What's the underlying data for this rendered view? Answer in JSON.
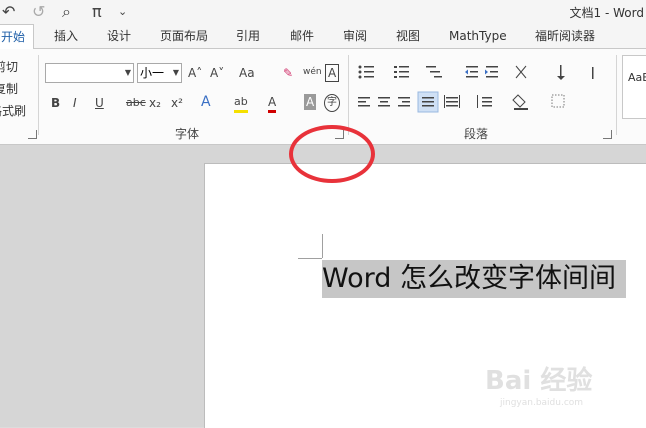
{
  "window": {
    "title": "文档1 - Word"
  },
  "qat": {
    "undo_icon": "↶",
    "redo_icon": "↺",
    "preview_icon": "⌕",
    "pi_icon": "π",
    "customize_icon": "⌄"
  },
  "tabs": [
    "开始",
    "插入",
    "设计",
    "页面布局",
    "引用",
    "邮件",
    "审阅",
    "视图",
    "MathType",
    "福昕阅读器"
  ],
  "clipboard": {
    "cut": "剪切",
    "copy": "复制",
    "format_painter": "格式刷"
  },
  "font_group": {
    "label": "字体",
    "font_name": "",
    "font_size": "小一",
    "grow": "A˄",
    "shrink": "A˅",
    "case": "Aa",
    "clear": "✎",
    "phonetic": "wén",
    "border": "A",
    "bold": "B",
    "italic": "I",
    "underline": "U",
    "strike": "abc",
    "subscript": "x₂",
    "superscript": "x²",
    "effects": "A",
    "highlight": "ab",
    "font_color": "A",
    "shading": "A",
    "enclose": "字"
  },
  "paragraph_group": {
    "label": "段落"
  },
  "styles": {
    "preview": "AaB"
  },
  "document": {
    "text": "Word 怎么改变字体间间"
  },
  "watermark": {
    "brand": "Bai 经验",
    "url": "jingyan.baidu.com"
  }
}
